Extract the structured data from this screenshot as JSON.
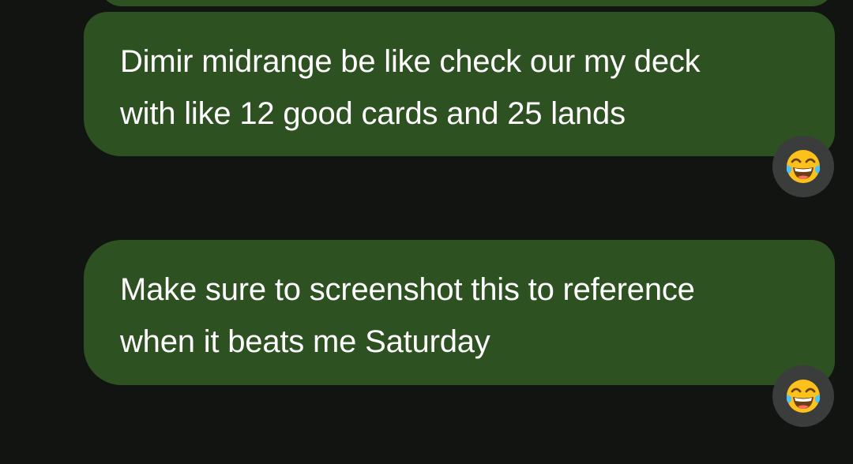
{
  "messages": [
    {
      "text": "Dimir midrange be like check our my deck\nwith like 12 good cards and 25 lands",
      "reaction": "face-with-tears-of-joy-icon"
    },
    {
      "text": "Make sure to screenshot this to reference\nwhen it beats me Saturday",
      "reaction": "face-with-tears-of-joy-icon"
    }
  ],
  "colors": {
    "background": "#121411",
    "bubble": "#2e5122",
    "reaction_chip": "#3a3d3b",
    "text": "#ffffff"
  }
}
